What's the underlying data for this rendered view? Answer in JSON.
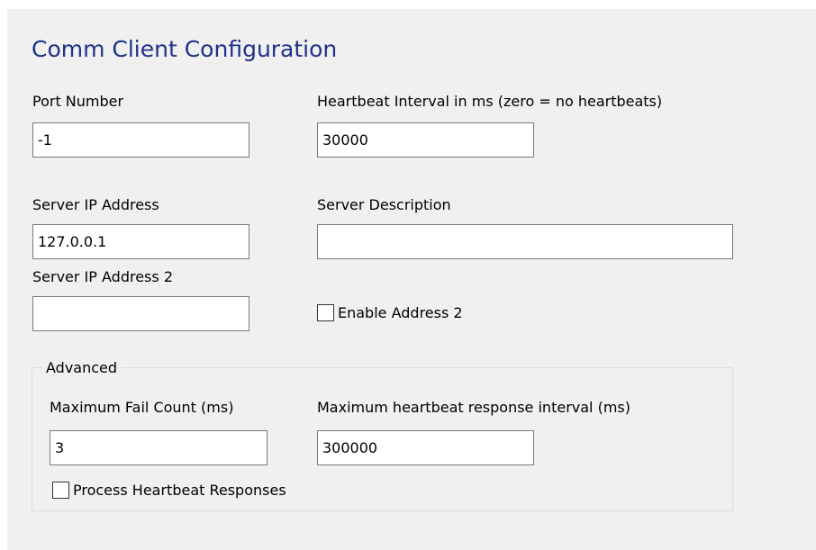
{
  "title": "Comm Client Configuration",
  "port": {
    "label": "Port Number",
    "value": "-1"
  },
  "heartbeat": {
    "label": "Heartbeat Interval in ms (zero = no heartbeats)",
    "value": "30000"
  },
  "server_ip": {
    "label": "Server IP Address",
    "value": "127.0.0.1"
  },
  "server_description": {
    "label": "Server Description",
    "value": ""
  },
  "server_ip2": {
    "label": "Server IP Address 2",
    "value": ""
  },
  "enable_address2": {
    "label": "Enable Address 2",
    "checked": false
  },
  "advanced": {
    "legend": "Advanced",
    "max_fail": {
      "label": "Maximum Fail Count (ms)",
      "value": "3"
    },
    "max_hb_response": {
      "label": "Maximum heartbeat response interval (ms)",
      "value": "300000"
    },
    "process_hb": {
      "label": "Process Heartbeat Responses",
      "checked": false
    }
  },
  "colors": {
    "title": "#1e3287",
    "panel_background": "#f0f0f0",
    "field_border": "#7a7a7a",
    "group_border": "#dcdcdc"
  }
}
